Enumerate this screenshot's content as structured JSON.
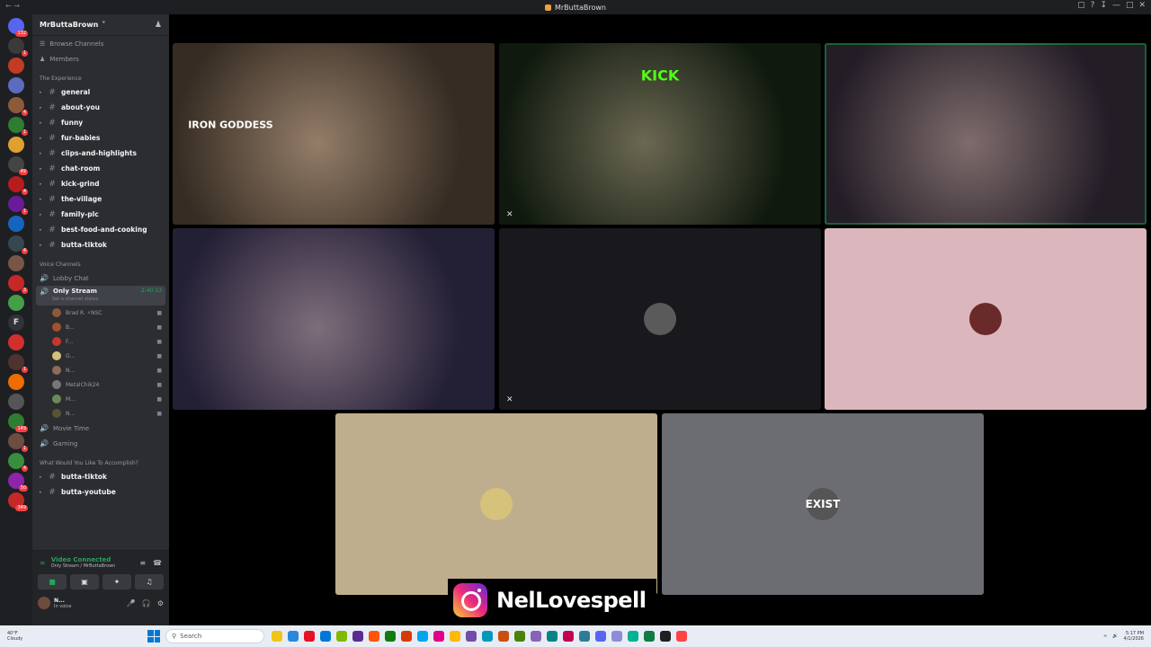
{
  "window": {
    "title": "MrButtaBrown"
  },
  "server": {
    "name": "MrButtaBrown"
  },
  "nav": {
    "browse": "Browse Channels",
    "members": "Members"
  },
  "categories": {
    "experience": "The Experience",
    "voice": "Voice Channels",
    "accomplish": "What Would You Like To Accomplish?"
  },
  "text_channels": [
    "general",
    "about-you",
    "funny",
    "fur-babies",
    "clips-and-highlights",
    "chat-room",
    "kick-grind",
    "the-village",
    "family-plc",
    "best-food-and-cooking",
    "butta-tiktok"
  ],
  "voice_channels": {
    "lobby": "Lobby Chat",
    "only_stream": "Only Stream",
    "only_stream_status": "Set a channel status",
    "timer": "2:40:13",
    "movie": "Movie Time",
    "gaming": "Gaming"
  },
  "voice_members": [
    {
      "name": "Brad R. ⚡NSC",
      "color": "#8b5a3c"
    },
    {
      "name": "B...",
      "color": "#a0522d"
    },
    {
      "name": "F...",
      "color": "#c0392b"
    },
    {
      "name": "G...",
      "color": "#d4c07a"
    },
    {
      "name": "N...",
      "color": "#8e6b5a"
    },
    {
      "name": "MetalChik24",
      "color": "#777"
    },
    {
      "name": "M...",
      "color": "#6a8a5a"
    },
    {
      "name": "N...",
      "color": "#553"
    }
  ],
  "bottom_channels": [
    "butta-tiktok",
    "butta-youtube"
  ],
  "voice_panel": {
    "status": "Video Connected",
    "sub": "Only Stream / MrButtaBrown",
    "user": "N...",
    "user_status": "In voice"
  },
  "server_badges": [
    "132",
    "1",
    "4",
    "1",
    "49",
    "4",
    "1",
    "4",
    "3",
    "1",
    "149",
    "1",
    "4",
    "50",
    "349"
  ],
  "server_f": "F",
  "tiles": [
    {
      "id": "cam1",
      "bg": "#5a4a3a",
      "speaking": false,
      "label": "IRON GODDESS"
    },
    {
      "id": "cam2",
      "bg": "#1b2a18",
      "speaking": false,
      "label": "KICK"
    },
    {
      "id": "cam3",
      "bg": "#3a3040",
      "speaking": true,
      "label": ""
    },
    {
      "id": "cam4",
      "bg": "#3a3358",
      "speaking": false,
      "label": ""
    },
    {
      "id": "av1",
      "bg": "#19181c",
      "speaking": false,
      "label": ""
    },
    {
      "id": "av2",
      "bg": "#dbb7bd",
      "speaking": false,
      "label": ""
    },
    {
      "id": "av3",
      "bg": "#bfae8d",
      "speaking": false,
      "label": ""
    },
    {
      "id": "av4",
      "bg": "#6c6d72",
      "speaking": false,
      "label": "EXIST"
    }
  ],
  "overlay": {
    "handle": "NelLovespell"
  },
  "taskbar": {
    "weather_temp": "40°F",
    "weather_desc": "Cloudy",
    "search": "Search",
    "time": "5:17 PM",
    "date": "4/1/2026"
  }
}
